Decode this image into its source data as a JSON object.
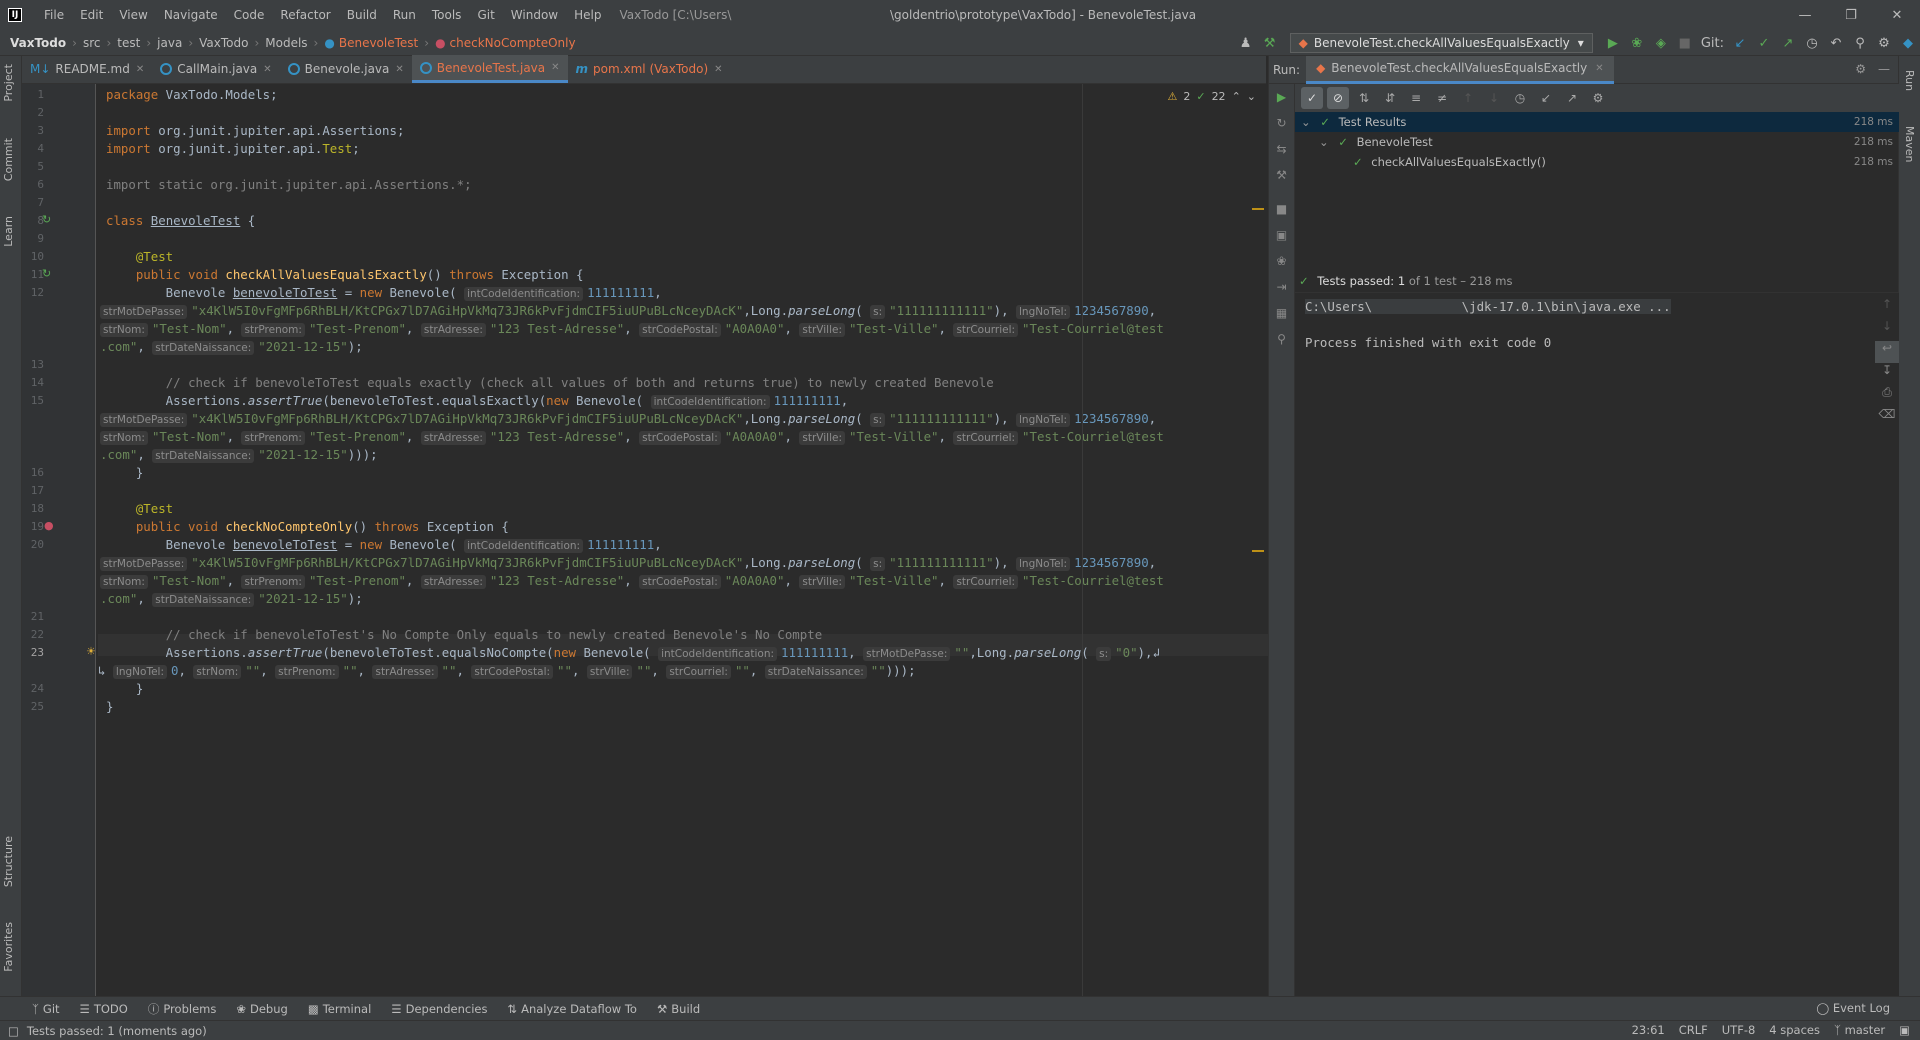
{
  "titlebar": {
    "menu": [
      "File",
      "Edit",
      "View",
      "Navigate",
      "Code",
      "Refactor",
      "Build",
      "Run",
      "Tools",
      "Git",
      "Window",
      "Help"
    ],
    "project": "VaxTodo [C:\\Users\\",
    "title": "\\goldentrio\\prototype\\VaxTodo] - BenevoleTest.java"
  },
  "navbar": {
    "crumbs": [
      "VaxTodo",
      "src",
      "test",
      "java",
      "VaxTodo",
      "Models",
      "BenevoleTest",
      "checkNoCompteOnly"
    ],
    "run_config": "BenevoleTest.checkAllValuesEqualsExactly",
    "git_label": "Git:"
  },
  "left_tabs": [
    "Project",
    "Commit",
    "Learn",
    "Structure",
    "Favorites"
  ],
  "right_tabs": [
    "Run",
    "Maven"
  ],
  "editor": {
    "tabs": [
      {
        "label": "README.md"
      },
      {
        "label": "CallMain.java"
      },
      {
        "label": "Benevole.java"
      },
      {
        "label": "BenevoleTest.java"
      },
      {
        "label": "pom.xml (VaxTodo)"
      }
    ],
    "inspections": {
      "warnings": "2",
      "passed": "22"
    },
    "line_numbers": [
      "1",
      "2",
      "3",
      "4",
      "5",
      "6",
      "7",
      "8",
      "9",
      "10",
      "11",
      "12",
      "13",
      "14",
      "15",
      "16",
      "17",
      "18",
      "19",
      "20",
      "21",
      "22",
      "23",
      "24",
      "25"
    ]
  },
  "run": {
    "label": "Run:",
    "tab": "BenevoleTest.checkAllValuesEqualsExactly",
    "tree": [
      {
        "label": "Test Results",
        "time": "218 ms"
      },
      {
        "label": "BenevoleTest",
        "time": "218 ms"
      },
      {
        "label": "checkAllValuesEqualsExactly()",
        "time": "218 ms"
      }
    ],
    "passed_bold": "Tests passed: 1",
    "passed_rest": "of 1 test – 218 ms",
    "console_line1": "C:\\Users\\            \\jdk-17.0.1\\bin\\java.exe ...",
    "console_line2": "Process finished with exit code 0"
  },
  "bottom_tools": [
    "Git",
    "TODO",
    "Problems",
    "Debug",
    "Terminal",
    "Dependencies",
    "Analyze Dataflow To",
    "Build"
  ],
  "event_log": "Event Log",
  "status": {
    "message": "Tests passed: 1 (moments ago)",
    "position": "23:61",
    "line_sep": "CRLF",
    "encoding": "UTF-8",
    "indent": "4 spaces",
    "branch": "master"
  }
}
